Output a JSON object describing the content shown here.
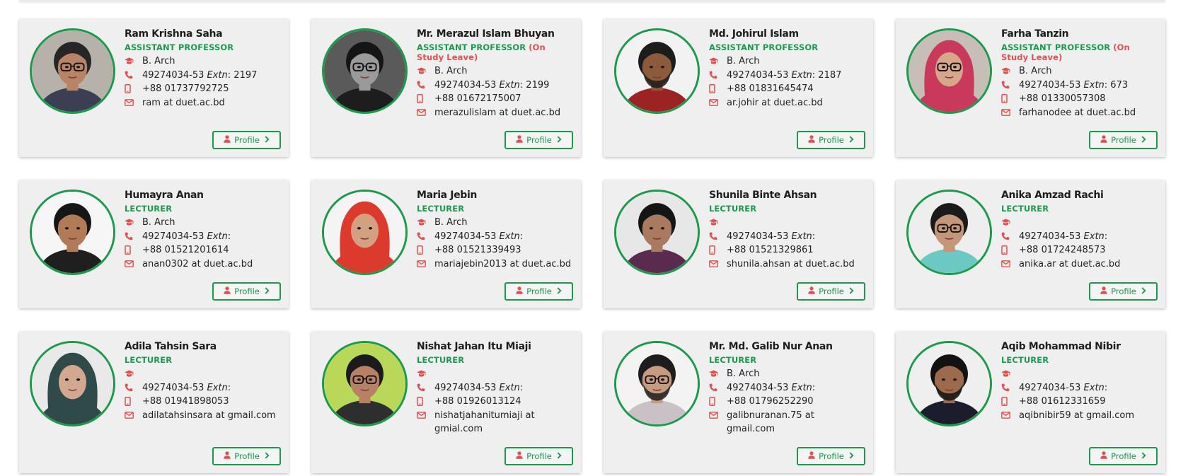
{
  "colors": {
    "accent_green": "#1b9a4c",
    "icon_red": "#e0504f",
    "card_bg": "#efefef"
  },
  "icons": {
    "degree": "graduation-cap-icon",
    "phone": "phone-icon",
    "mobile": "mobile-icon",
    "email": "envelope-icon",
    "profile_user": "user-icon",
    "profile_arrow": "chevron-right-icon"
  },
  "faculty": [
    {
      "name": "Ram Krishna Saha",
      "designation": "ASSISTANT PROFESSOR",
      "note": "",
      "degree": "B. Arch",
      "phone": "49274034-53",
      "extn_label": "Extn",
      "extn": ": 2197",
      "mobile": "+88 01737792725",
      "email": "ram at duet.ac.bd",
      "profile_label": "Profile",
      "photo": {
        "bg": "#b6b2aa",
        "skin": "#b98466",
        "hair": "#262626",
        "cloth": "#3a3f54",
        "scarf": false,
        "glasses": true,
        "beard": false,
        "gray": false
      }
    },
    {
      "name": "Mr. Merazul Islam Bhuyan",
      "designation": "ASSISTANT PROFESSOR",
      "note": " (On Study Leave)",
      "degree": "B. Arch",
      "phone": "49274034-53",
      "extn_label": "Extn",
      "extn": ": 2199",
      "mobile": "+88 01672175007",
      "email": "merazulislam at duet.ac.bd",
      "profile_label": "Profile",
      "photo": {
        "bg": "#5a5a5a",
        "skin": "#9a9a9a",
        "hair": "#151515",
        "cloth": "#1d1d1d",
        "scarf": false,
        "glasses": true,
        "beard": false,
        "gray": true
      }
    },
    {
      "name": "Md. Johirul Islam",
      "designation": "ASSISTANT PROFESSOR",
      "note": "",
      "degree": "B. Arch",
      "phone": "49274034-53",
      "extn_label": "Extn",
      "extn": ": 2187",
      "mobile": "+88 01831645474",
      "email": "ar.johir at duet.ac.bd",
      "profile_label": "Profile",
      "photo": {
        "bg": "#f2f2f2",
        "skin": "#8d5a3c",
        "hair": "#1c1c1c",
        "cloth": "#9c2323",
        "scarf": false,
        "glasses": false,
        "beard": true,
        "gray": false
      }
    },
    {
      "name": "Farha Tanzin",
      "designation": "ASSISTANT PROFESSOR",
      "note": " (On Study Leave)",
      "degree": "B. Arch",
      "phone": "49274034-53",
      "extn_label": "Extn",
      "extn": ": 673",
      "mobile": "+88 01330057308",
      "email": "farhanodee at duet.ac.bd",
      "profile_label": "Profile",
      "photo": {
        "bg": "#c7bfb7",
        "skin": "#d6a78a",
        "hair": "#c9395b",
        "cloth": "#c23a5e",
        "scarf": true,
        "glasses": true,
        "beard": false,
        "gray": false
      }
    },
    {
      "name": "Humayra Anan",
      "designation": "LECTURER",
      "note": "",
      "degree": "B. Arch",
      "phone": "49274034-53",
      "extn_label": "Extn",
      "extn": ":",
      "mobile": "+88 01521201614",
      "email": "anan0302 at duet.ac.bd",
      "profile_label": "Profile",
      "photo": {
        "bg": "#f6f6f6",
        "skin": "#b17b58",
        "hair": "#161616",
        "cloth": "#1f1f1f",
        "scarf": false,
        "glasses": false,
        "beard": false,
        "gray": false
      }
    },
    {
      "name": "Maria Jebin",
      "designation": "LECTURER",
      "note": "",
      "degree": "B. Arch",
      "phone": "49274034-53",
      "extn_label": "Extn",
      "extn": ":",
      "mobile": "+88 01521339493",
      "email": "mariajebin2013 at duet.ac.bd",
      "profile_label": "Profile",
      "photo": {
        "bg": "#f4f4f4",
        "skin": "#d3a182",
        "hair": "#dc3a2c",
        "cloth": "#dc3a2c",
        "scarf": true,
        "glasses": false,
        "beard": false,
        "gray": false
      }
    },
    {
      "name": "Shunila Binte Ahsan",
      "designation": "LECTURER",
      "note": "",
      "degree": "",
      "phone": "49274034-53",
      "extn_label": "Extn",
      "extn": ":",
      "mobile": "+88 01521329861",
      "email": "shunila.ahsan at duet.ac.bd",
      "profile_label": "Profile",
      "photo": {
        "bg": "#e7e7e7",
        "skin": "#a97a5f",
        "hair": "#151515",
        "cloth": "#5b2a4f",
        "scarf": false,
        "glasses": false,
        "beard": false,
        "gray": false
      }
    },
    {
      "name": "Anika Amzad Rachi",
      "designation": "LECTURER",
      "note": "",
      "degree": "",
      "phone": "49274034-53",
      "extn_label": "Extn",
      "extn": ":",
      "mobile": "+88 01724248573",
      "email": "anika.ar at duet.ac.bd",
      "profile_label": "Profile",
      "photo": {
        "bg": "#eeeeee",
        "skin": "#c4977a",
        "hair": "#1a1a1a",
        "cloth": "#6cc8c2",
        "scarf": false,
        "glasses": true,
        "beard": false,
        "gray": false
      }
    },
    {
      "name": "Adila Tahsin Sara",
      "designation": "LECTURER",
      "note": "",
      "degree": "",
      "phone": "49274034-53",
      "extn_label": "Extn",
      "extn": ":",
      "mobile": "+88 01941898053",
      "email": "adilatahsinsara at gmail.com",
      "profile_label": "Profile",
      "photo": {
        "bg": "#e9e9e9",
        "skin": "#d3a891",
        "hair": "#2f4a49",
        "cloth": "#2f4a49",
        "scarf": true,
        "glasses": false,
        "beard": false,
        "gray": false
      }
    },
    {
      "name": "Nishat Jahan Itu Miaji",
      "designation": "LECTURER",
      "note": "",
      "degree": "",
      "phone": "49274034-53",
      "extn_label": "Extn",
      "extn": ":",
      "mobile": "+88 01926013124",
      "email": "nishatjahanitumiaji at gmial.com",
      "profile_label": "Profile",
      "photo": {
        "bg": "#b9d85a",
        "skin": "#b88166",
        "hair": "#1b1b1b",
        "cloth": "#2e2e2e",
        "scarf": false,
        "glasses": true,
        "beard": false,
        "gray": false
      }
    },
    {
      "name": "Mr. Md. Galib Nur Anan",
      "designation": "LECTURER",
      "note": "",
      "degree": "B. Arch",
      "phone": "49274034-53",
      "extn_label": "Extn",
      "extn": ":",
      "mobile": "+88 01796252290",
      "email": "galibnuranan.75 at gmail.com",
      "profile_label": "Profile",
      "photo": {
        "bg": "#f3f3f3",
        "skin": "#c89b80",
        "hair": "#1d1d1d",
        "cloth": "#c9c1c6",
        "scarf": false,
        "glasses": true,
        "beard": true,
        "gray": false
      }
    },
    {
      "name": "Aqib Mohammad Nibir",
      "designation": "LECTURER",
      "note": "",
      "degree": "",
      "phone": "49274034-53",
      "extn_label": "Extn",
      "extn": ":",
      "mobile": "+88 01612331659",
      "email": "aqibnibir59 at gmail.com",
      "profile_label": "Profile",
      "photo": {
        "bg": "#efefef",
        "skin": "#9d6a4e",
        "hair": "#121212",
        "cloth": "#1b1d2c",
        "scarf": false,
        "glasses": false,
        "beard": true,
        "gray": false
      }
    }
  ]
}
